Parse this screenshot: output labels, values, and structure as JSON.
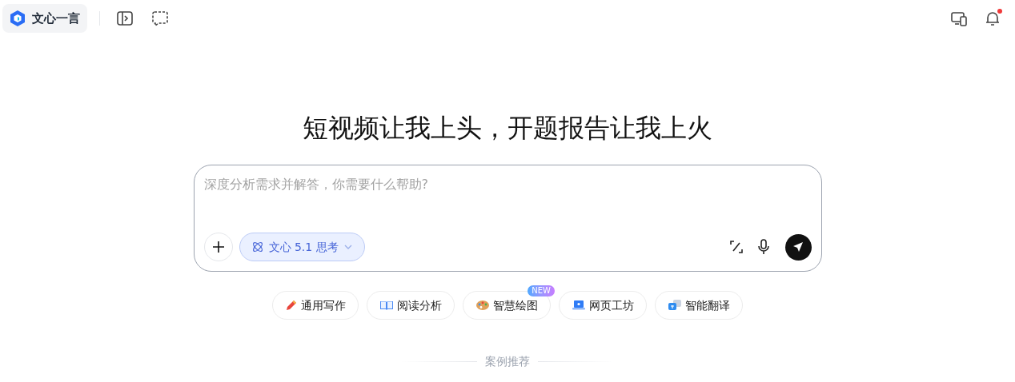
{
  "header": {
    "logo_text": "文心一言",
    "notifications": {
      "unread": true
    }
  },
  "headline": "短视频让我上头，开题报告让我上火",
  "composer": {
    "placeholder": "深度分析需求并解答，你需要什么帮助?",
    "model": "文心 5.1 思考"
  },
  "chips": [
    {
      "kind": "pencil",
      "label": "通用写作"
    },
    {
      "kind": "book",
      "label": "阅读分析"
    },
    {
      "kind": "palette",
      "label": "智慧绘图",
      "badge": "NEW"
    },
    {
      "kind": "laptop",
      "label": "网页工坊"
    },
    {
      "kind": "translate",
      "label": "智能翻译"
    }
  ],
  "section_label": "案例推荐"
}
